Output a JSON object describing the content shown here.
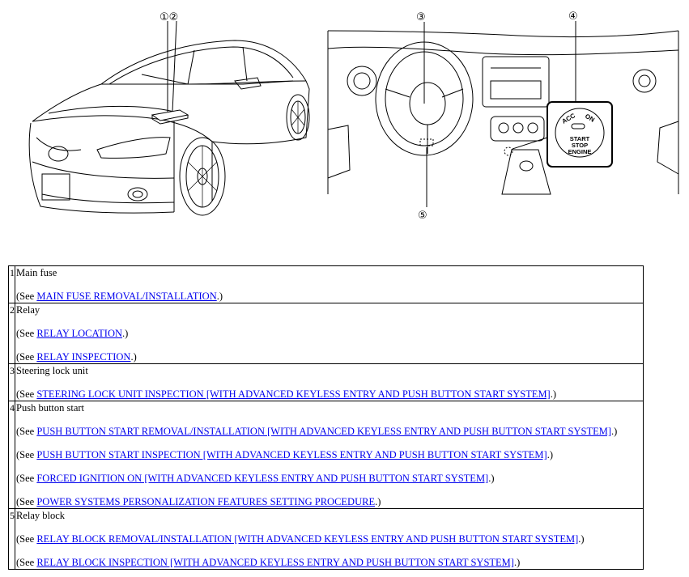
{
  "figure": {
    "callouts": [
      "①②",
      "③",
      "④",
      "⑤"
    ],
    "switch_labels": {
      "acc": "ACC",
      "on": "ON",
      "start": "START",
      "stop": "STOP",
      "engine": "ENGINE"
    }
  },
  "items": [
    {
      "num": "1",
      "name": "Main fuse",
      "refs": [
        {
          "prefix": "(See ",
          "link": "MAIN FUSE REMOVAL/INSTALLATION",
          "suffix": ".)"
        }
      ]
    },
    {
      "num": "2",
      "name": "Relay",
      "refs": [
        {
          "prefix": "(See ",
          "link": "RELAY LOCATION",
          "suffix": ".)"
        },
        {
          "prefix": "(See ",
          "link": "RELAY INSPECTION",
          "suffix": ".)"
        }
      ]
    },
    {
      "num": "3",
      "name": "Steering lock unit",
      "refs": [
        {
          "prefix": "(See ",
          "link": "STEERING LOCK UNIT INSPECTION [WITH ADVANCED KEYLESS ENTRY AND PUSH BUTTON START SYSTEM]",
          "suffix": ".)"
        }
      ]
    },
    {
      "num": "4",
      "name": "Push button start",
      "refs": [
        {
          "prefix": "(See ",
          "link": "PUSH BUTTON START REMOVAL/INSTALLATION [WITH ADVANCED KEYLESS ENTRY AND PUSH BUTTON START SYSTEM]",
          "suffix": ".)"
        },
        {
          "prefix": "(See ",
          "link": "PUSH BUTTON START INSPECTION [WITH ADVANCED KEYLESS ENTRY AND PUSH BUTTON START SYSTEM]",
          "suffix": ".)"
        },
        {
          "prefix": "(See ",
          "link": "FORCED IGNITION ON [WITH ADVANCED KEYLESS ENTRY AND PUSH BUTTON START SYSTEM]",
          "suffix": ".)"
        },
        {
          "prefix": "(See ",
          "link": "POWER SYSTEMS PERSONALIZATION FEATURES SETTING PROCEDURE",
          "suffix": ".)"
        }
      ]
    },
    {
      "num": "5",
      "name": "Relay block",
      "refs": [
        {
          "prefix": "(See ",
          "link": "RELAY BLOCK REMOVAL/INSTALLATION [WITH ADVANCED KEYLESS ENTRY AND PUSH BUTTON START SYSTEM]",
          "suffix": ".)"
        },
        {
          "prefix": "(See ",
          "link": "RELAY BLOCK INSPECTION [WITH ADVANCED KEYLESS ENTRY AND PUSH BUTTON START SYSTEM]",
          "suffix": ".)"
        }
      ]
    }
  ]
}
